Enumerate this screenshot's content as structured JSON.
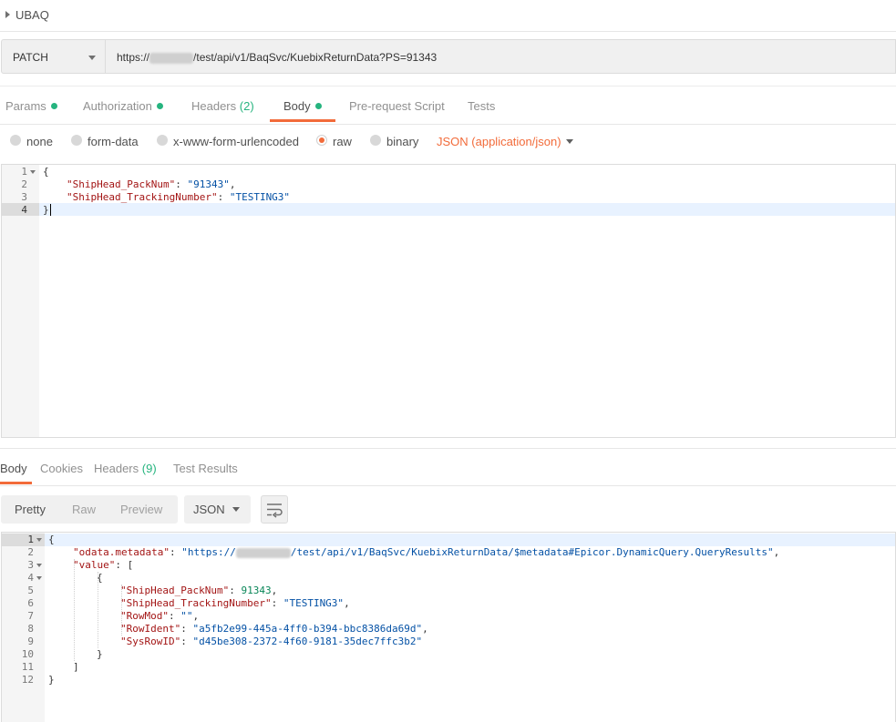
{
  "collection": {
    "name": "UBAQ"
  },
  "request": {
    "method": "PATCH",
    "url_prefix": "https://",
    "url_suffix": "/test/api/v1/BaqSvc/KuebixReturnData?PS=91343"
  },
  "request_tabs": {
    "params": "Params",
    "authorization": "Authorization",
    "headers": "Headers",
    "headers_count": "(2)",
    "body": "Body",
    "prerequest": "Pre-request Script",
    "tests": "Tests"
  },
  "body_types": {
    "none": "none",
    "form_data": "form-data",
    "urlencoded": "x-www-form-urlencoded",
    "raw": "raw",
    "binary": "binary",
    "content_type": "JSON (application/json)"
  },
  "request_body": {
    "line_numbers": [
      "1",
      "2",
      "3",
      "4"
    ],
    "open": "{",
    "close": "}",
    "key1": "\"ShipHead_PackNum\"",
    "val1": "\"91343\"",
    "key2": "\"ShipHead_TrackingNumber\"",
    "val2": "\"TESTING3\""
  },
  "response_tabs": {
    "body": "Body",
    "cookies": "Cookies",
    "headers": "Headers",
    "headers_count": "(9)",
    "test_results": "Test Results"
  },
  "response_view": {
    "pretty": "Pretty",
    "raw": "Raw",
    "preview": "Preview",
    "format": "JSON"
  },
  "response_body": {
    "line_numbers": [
      "1",
      "2",
      "3",
      "4",
      "5",
      "6",
      "7",
      "8",
      "9",
      "10",
      "11",
      "12"
    ],
    "open": "{",
    "k_meta": "\"odata.metadata\"",
    "v_meta_prefix": "\"https://",
    "v_meta_suffix": "/test/api/v1/BaqSvc/KuebixReturnData/$metadata#Epicor.DynamicQuery.QueryResults\"",
    "k_value": "\"value\"",
    "arr_open": "[",
    "obj_open": "{",
    "k_packnum": "\"ShipHead_PackNum\"",
    "v_packnum": "91343",
    "k_tracking": "\"ShipHead_TrackingNumber\"",
    "v_tracking": "\"TESTING3\"",
    "k_rowmod": "\"RowMod\"",
    "v_rowmod": "\"\"",
    "k_rowident": "\"RowIdent\"",
    "v_rowident": "\"a5fb2e99-445a-4ff0-b394-bbc8386da69d\"",
    "k_sysrowid": "\"SysRowID\"",
    "v_sysrowid": "\"d45be308-2372-4f60-9181-35dec7ffc3b2\"",
    "obj_close": "}",
    "arr_close": "]",
    "close": "}"
  },
  "colors": {
    "accent": "#f26b3a",
    "status_dot": "#26b47f"
  }
}
